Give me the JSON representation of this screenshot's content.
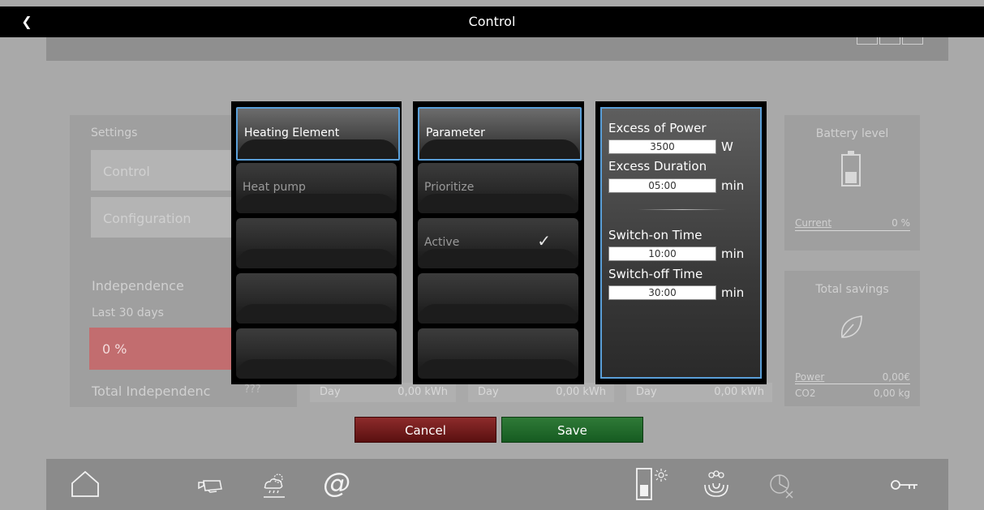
{
  "header": {
    "title": "Control",
    "back_glyph": "❮"
  },
  "background": {
    "settings": {
      "label": "Settings",
      "control_label": "Control",
      "configuration_label": "Configuration",
      "independence_label": "Independence",
      "last30_label": "Last 30 days",
      "independence_value": "0 %",
      "total_independence_label": "Total Independenc",
      "total_independence_value": "???"
    },
    "stats": [
      {
        "period": "Day",
        "value": "0,00 kWh"
      },
      {
        "period": "Day",
        "value": "0,00 kWh"
      },
      {
        "period": "Day",
        "value": "0,00 kWh"
      }
    ],
    "battery": {
      "title": "Battery level",
      "current_label": "Current",
      "current_value": "0 %"
    },
    "savings": {
      "title": "Total savings",
      "power_label": "Power",
      "power_value": "0,00€",
      "co2_label": "CO2",
      "co2_value": "0,00 kg"
    }
  },
  "device_list": {
    "items": [
      {
        "label": "Heating Element",
        "selected": true
      },
      {
        "label": "Heat pump",
        "selected": false
      },
      {
        "label": ""
      },
      {
        "label": ""
      },
      {
        "label": ""
      }
    ]
  },
  "mode_list": {
    "items": [
      {
        "label": "Parameter",
        "selected": true
      },
      {
        "label": "Prioritize"
      },
      {
        "label": "Active",
        "check": "✓"
      },
      {
        "label": ""
      },
      {
        "label": ""
      }
    ]
  },
  "parameters": {
    "excess_power": {
      "label": "Excess of Power",
      "value": "3500",
      "unit": "W"
    },
    "excess_duration": {
      "label": "Excess Duration",
      "value": "05:00",
      "unit": "min"
    },
    "switch_on": {
      "label": "Switch-on Time",
      "value": "10:00",
      "unit": "min"
    },
    "switch_off": {
      "label": "Switch-off Time",
      "value": "30:00",
      "unit": "min"
    }
  },
  "dialog": {
    "cancel_label": "Cancel",
    "save_label": "Save"
  },
  "bottom_bar": {
    "icons": [
      "home-icon",
      "camera-icon",
      "weather-icon",
      "at-icon",
      "battery-sun-icon",
      "heating-icon",
      "pie-chart-icon",
      "key-icon"
    ],
    "at_glyph": "@"
  },
  "colors": {
    "accent_blue": "#5a9fd8",
    "cancel_red": "#8d2b2b",
    "save_green": "#2f7a37",
    "independence_red": "#c26d6f"
  }
}
